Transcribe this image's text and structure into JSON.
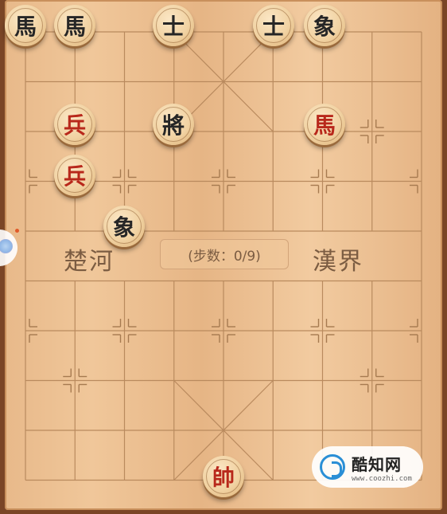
{
  "game": "chinese-chess",
  "board": {
    "river_left": "楚河",
    "river_right": "漢界",
    "step_counter": "(步数：0/9)"
  },
  "pieces": {
    "black_horse_1": "馬",
    "black_horse_2": "馬",
    "black_advisor_1": "士",
    "black_advisor_2": "士",
    "black_elephant_1": "象",
    "black_general": "將",
    "black_elephant_2": "象",
    "red_soldier_1": "兵",
    "red_soldier_2": "兵",
    "red_horse": "馬",
    "red_general": "帥"
  },
  "watermark": {
    "title": "酷知网",
    "url": "www.coozhi.com"
  },
  "colors": {
    "board": "#f0c79a",
    "black_piece_text": "#262626",
    "red_piece_text": "#b8281b",
    "frame": "#7a4526"
  }
}
